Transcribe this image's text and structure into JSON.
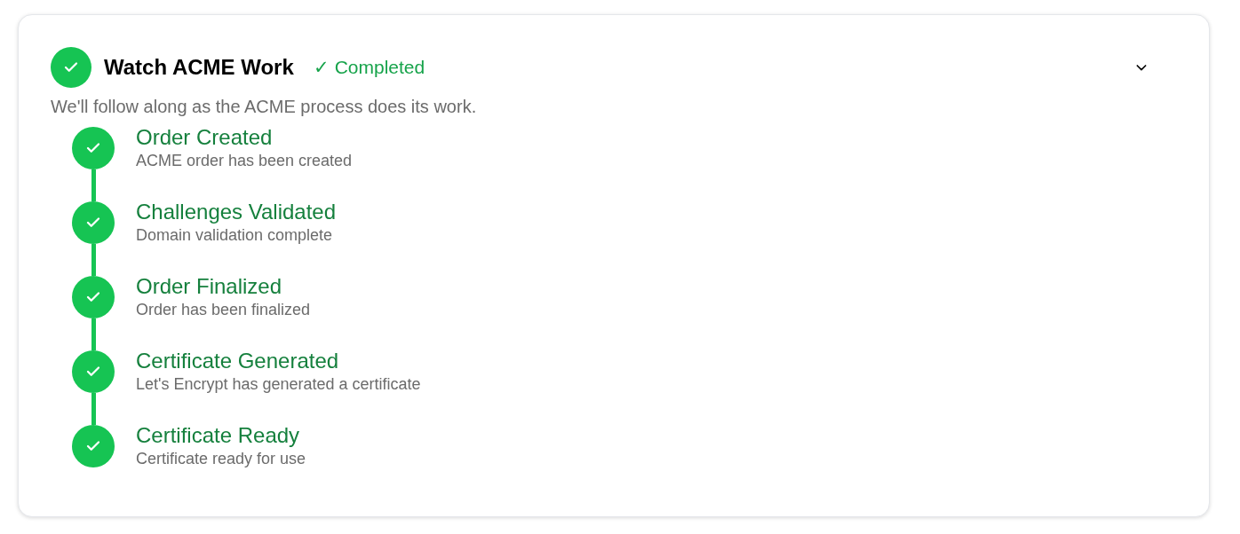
{
  "panel": {
    "title": "Watch ACME Work",
    "done": true,
    "status": "✓ Completed",
    "expanded": true,
    "description": "We'll follow along as the ACME process does its work."
  },
  "steps": [
    {
      "title": "Order Created",
      "subtitle": "ACME order has been created",
      "done": true
    },
    {
      "title": "Challenges Validated",
      "subtitle": "Domain validation complete",
      "done": true
    },
    {
      "title": "Order Finalized",
      "subtitle": "Order has been finalized",
      "done": true
    },
    {
      "title": "Certificate Generated",
      "subtitle": "Let's Encrypt has generated a certificate",
      "done": true
    },
    {
      "title": "Certificate Ready",
      "subtitle": "Certificate ready for use",
      "done": true
    }
  ]
}
